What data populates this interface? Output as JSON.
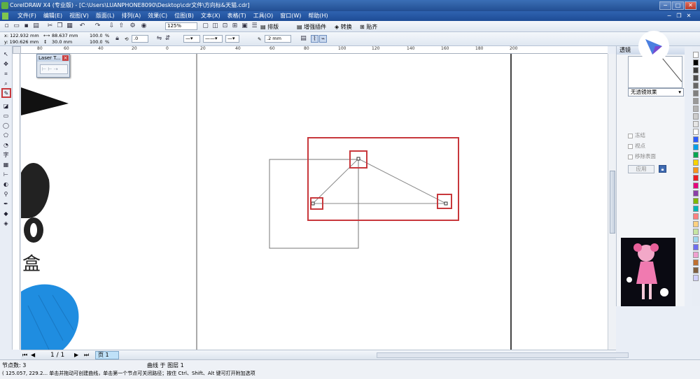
{
  "window": {
    "title": "CorelDRAW X4 (专业版) - [C:\\Users\\LUANPHONE8090\\Desktop\\cdr文件\\方向标&天猫.cdr]",
    "minimize": "−",
    "maximize": "□",
    "close": "✕"
  },
  "menu": {
    "items": [
      "文件(F)",
      "编辑(E)",
      "视图(V)",
      "版面(L)",
      "排列(A)",
      "效果(C)",
      "位图(B)",
      "文本(X)",
      "表格(T)",
      "工具(O)",
      "窗口(W)",
      "帮助(H)"
    ]
  },
  "toolbar1": {
    "zoom": "125%",
    "arrange_label": "排版",
    "plugins_label": "增强插件",
    "convert_label": "转换",
    "snap_label": "贴齐"
  },
  "toolbar2": {
    "x": "x: 122.932 mm",
    "y": "y: 190.626 mm",
    "w": "88.637 mm",
    "h": "30.0 mm",
    "scale_w": "100.0",
    "scale_h": "100.0",
    "percent": "%",
    "rotation": ".0",
    "nodes": "0",
    "outline_width": ".2 mm"
  },
  "ruler": {
    "top_ticks": [
      "80",
      "60",
      "40",
      "20",
      "0",
      "20",
      "40",
      "60",
      "80",
      "100",
      "120",
      "140",
      "160",
      "180",
      "200"
    ]
  },
  "laser_window": {
    "title": "Laser T...",
    "close": "×"
  },
  "canvas": {
    "text_glyph": "盒"
  },
  "docker": {
    "title": "透镜",
    "effect_select": "无透镜效果",
    "checkboxes": [
      "冻结",
      "视点",
      "移除表面"
    ],
    "apply_label": "应用"
  },
  "pagebar": {
    "page_count": "1 / 1",
    "page_tab": "页 1"
  },
  "status": {
    "nodes_count": "节点数: 3",
    "object_info": "曲线 于 图层 1",
    "coords_hint": "( 125.057, 229.2... 单击并拖动可创建曲线，单击第一个节点可关闭路径；按住 Ctrl、Shift、Alt 键可打开附加选项"
  },
  "colors": {
    "accent_red": "#c8383c",
    "title_blue": "#2a5aa4",
    "shape_blue": "#1f8de0"
  }
}
